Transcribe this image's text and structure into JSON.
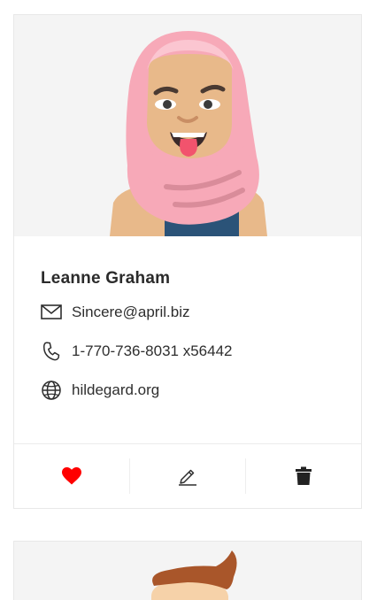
{
  "cards": [
    {
      "name": "Leanne Graham",
      "email": "Sincere@april.biz",
      "phone": "1-770-736-8031 x56442",
      "website": "hildegard.org",
      "avatar": "avatar-woman-hijab-tongue-out",
      "actions": [
        {
          "icon": "heart-icon",
          "state": "liked",
          "color": "#ff0000"
        },
        {
          "icon": "edit-icon"
        },
        {
          "icon": "delete-icon"
        }
      ]
    },
    {
      "avatar": "avatar-man-brown-hair"
    }
  ],
  "colors": {
    "card_border": "#e8e8e8",
    "avatar_background": "#f4f4f4",
    "heart": "#ff0000",
    "text": "#2e2e2e"
  }
}
